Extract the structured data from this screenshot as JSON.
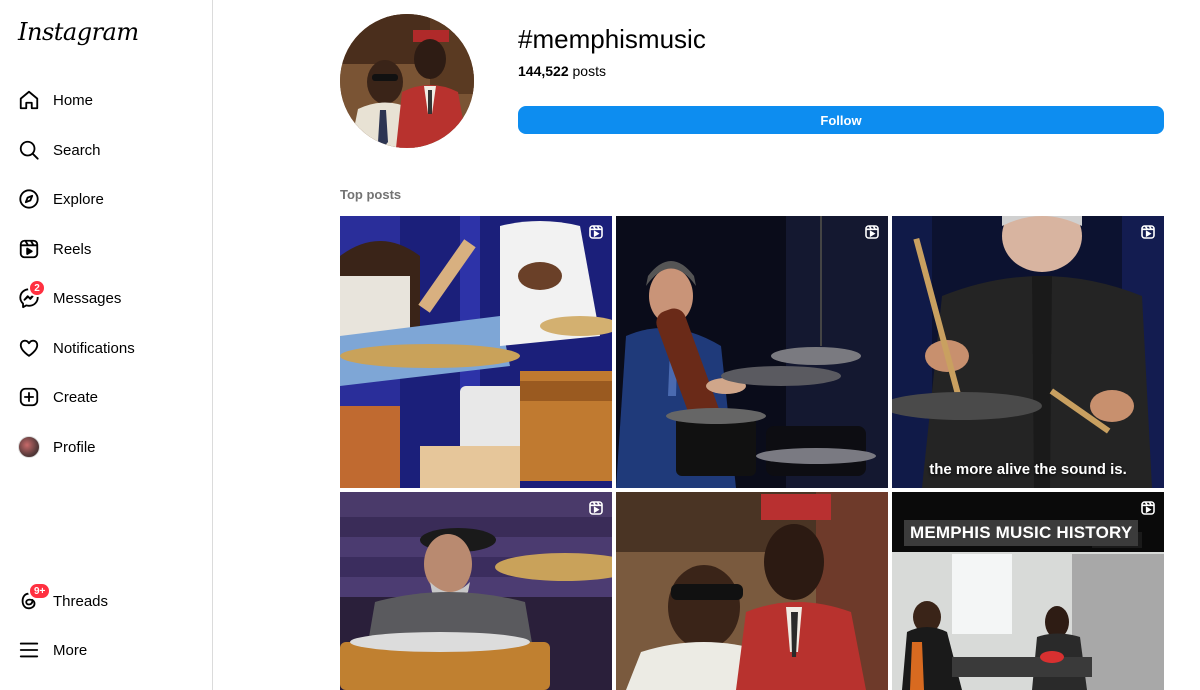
{
  "app": {
    "logo": "Instagram"
  },
  "sidebar": {
    "items": [
      {
        "label": "Home",
        "icon": "home-icon"
      },
      {
        "label": "Search",
        "icon": "search-icon"
      },
      {
        "label": "Explore",
        "icon": "compass-icon"
      },
      {
        "label": "Reels",
        "icon": "reels-icon"
      },
      {
        "label": "Messages",
        "icon": "messenger-icon",
        "badge": "2"
      },
      {
        "label": "Notifications",
        "icon": "heart-icon"
      },
      {
        "label": "Create",
        "icon": "plus-square-icon"
      },
      {
        "label": "Profile",
        "icon": "avatar"
      }
    ],
    "bottom": [
      {
        "label": "Threads",
        "icon": "threads-icon",
        "badge": "9+"
      },
      {
        "label": "More",
        "icon": "menu-icon"
      }
    ]
  },
  "header": {
    "hashtag": "#memphismusic",
    "post_count": "144,522",
    "post_suffix": " posts",
    "follow_label": "Follow"
  },
  "top_posts": {
    "label": "Top posts",
    "tiles": [
      {
        "caption": "",
        "reel": true
      },
      {
        "caption": "",
        "reel": true
      },
      {
        "caption": "the more alive the sound is.",
        "reel": true
      },
      {
        "caption": "",
        "reel": true
      },
      {
        "caption": "",
        "reel": false
      },
      {
        "overlay": "MEMPHIS MUSIC HISTORY",
        "caption": "",
        "reel": true
      }
    ]
  },
  "colors": {
    "accent": "#0d8df0",
    "badge": "#ff3040"
  }
}
